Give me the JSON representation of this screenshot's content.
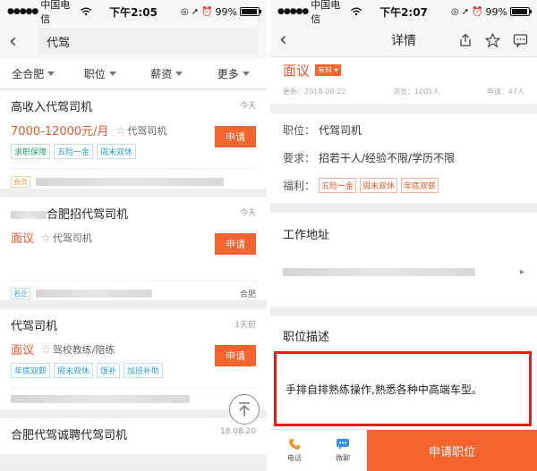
{
  "left": {
    "status": {
      "carrier": "中国电信",
      "time": "下午2:05",
      "battery": "99%"
    },
    "search": {
      "value": "代驾"
    },
    "filters": [
      "全合肥",
      "职位",
      "薪资",
      "更多"
    ],
    "cards": [
      {
        "title": "高收入代驾司机",
        "time": "今天",
        "salary": "7000-12000元/月",
        "company": "代驾司机",
        "tags": [
          "求职保障",
          "五险一金",
          "周末双休"
        ],
        "apply": "申请",
        "foot_tag": "会员",
        "city": ""
      },
      {
        "title": "合肥招代驾司机",
        "time": "今天",
        "salary": "面议",
        "company": "代驾司机",
        "tags": [],
        "apply": "申请",
        "foot_tag": "名企",
        "city": "合肥"
      },
      {
        "title": "代驾司机",
        "time": "1天前",
        "salary": "面议",
        "company": "驾校教练/陪练",
        "tags": [
          "年底双薪",
          "周末双休",
          "饭补",
          "加班补助"
        ],
        "apply": "申请",
        "foot_tag": "",
        "city": ""
      },
      {
        "title": "合肥代驾诚聘代驾司机",
        "time": "18.08.20",
        "salary": "",
        "company": "",
        "tags": [],
        "apply": "",
        "foot_tag": "",
        "city": ""
      }
    ]
  },
  "right": {
    "status": {
      "carrier": "中国电信",
      "time": "下午2:07",
      "battery": "99%"
    },
    "nav_title": "详情",
    "salary": "面议",
    "badge": "有料",
    "meta": {
      "updated": "更新：2018-08-22",
      "views": "浏览：1005人",
      "applied": "申请：47人"
    },
    "info": {
      "position_key": "职位：",
      "position": "代驾司机",
      "require_key": "要求：",
      "require": "招若干人/经验不限/学历不限",
      "welfare_key": "福利：",
      "welfare": [
        "五险一金",
        "周末双休",
        "年底双薪"
      ]
    },
    "address_title": "工作地址",
    "desc_title": "职位描述",
    "desc": "手排自排熟练操作,熟悉各种中高端车型。",
    "bottom": {
      "phone": "电话",
      "chat": "微聊",
      "apply": "申请职位"
    }
  }
}
